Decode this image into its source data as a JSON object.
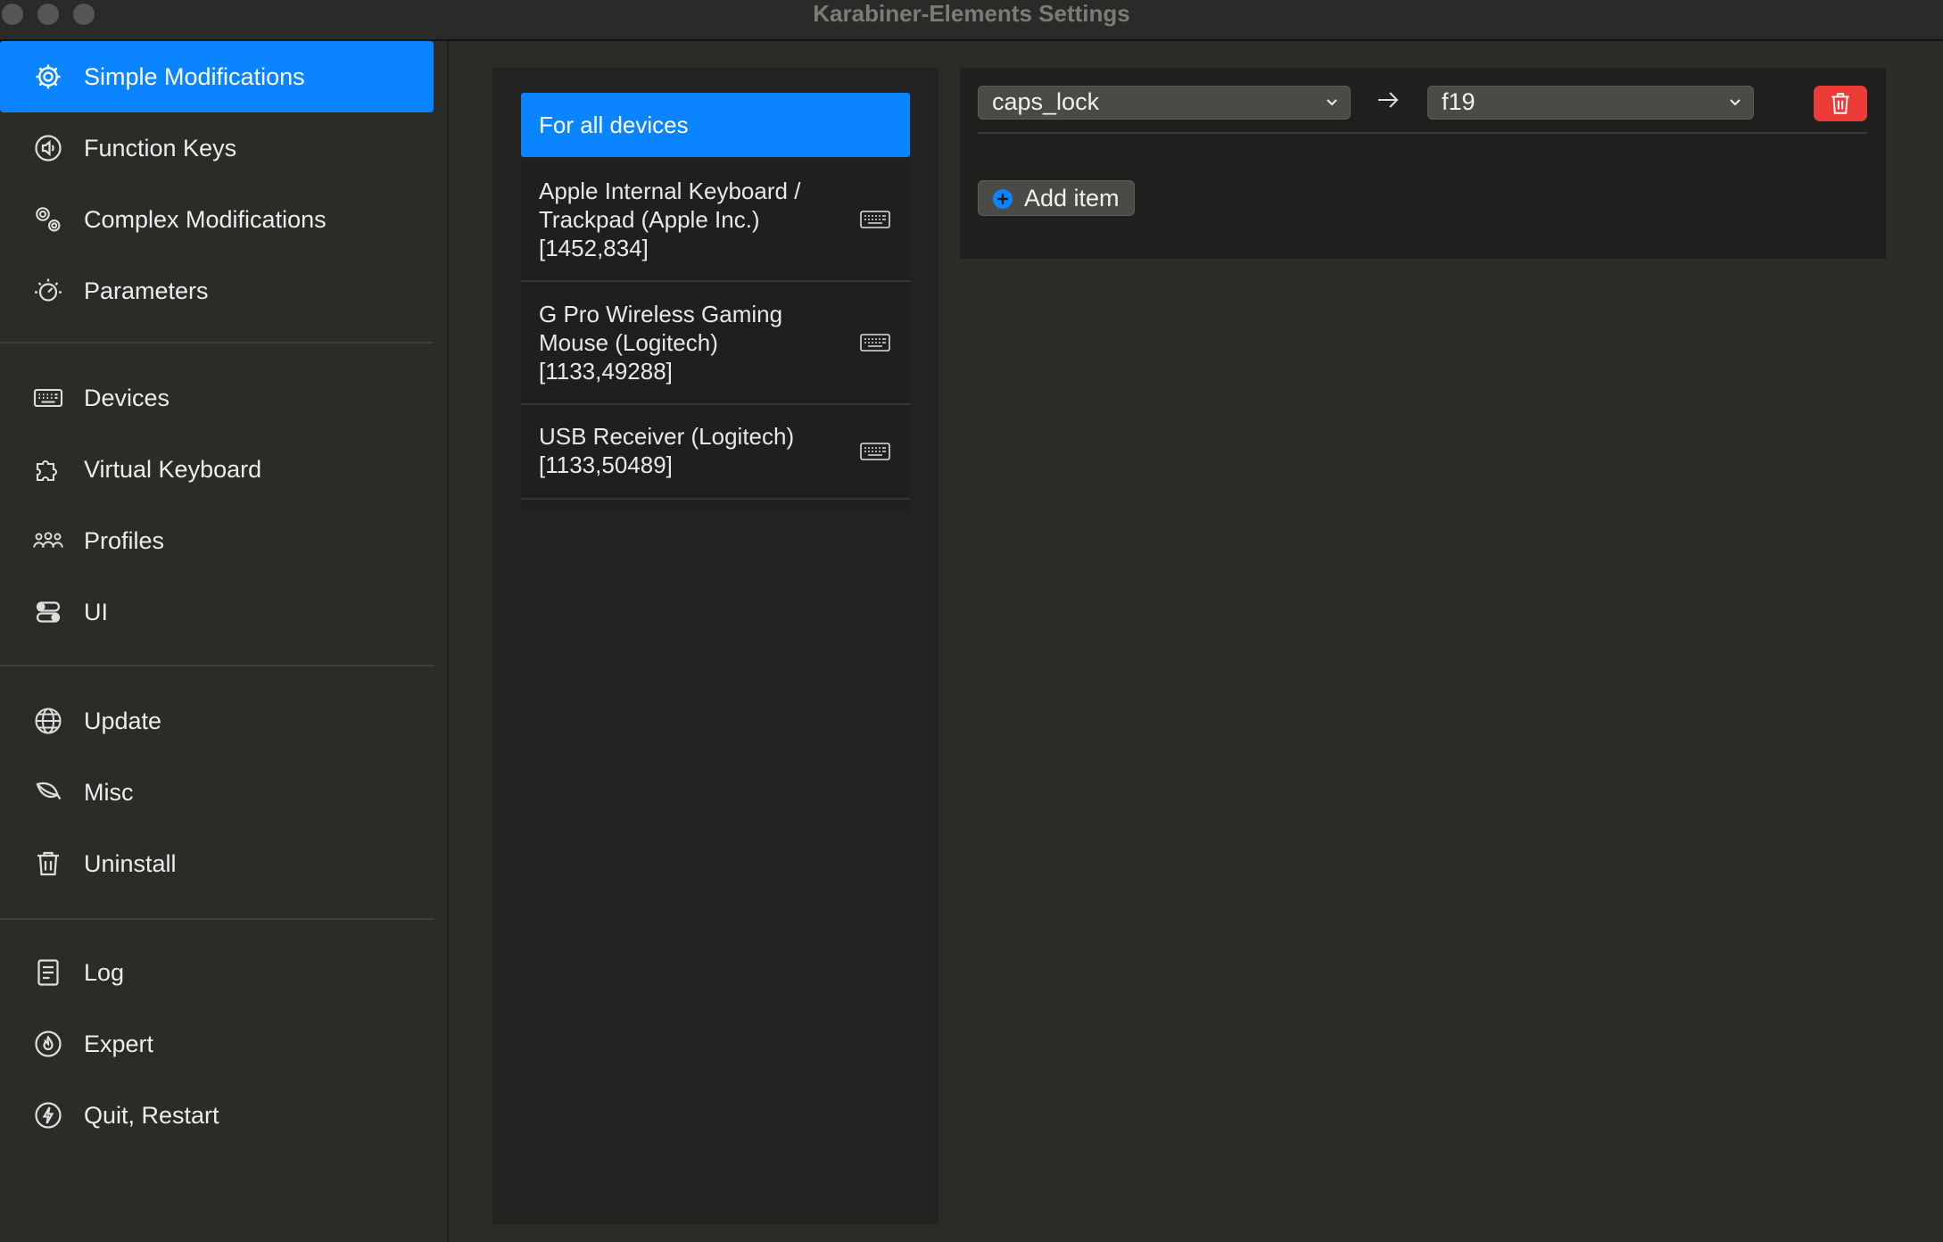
{
  "window": {
    "title": "Karabiner-Elements Settings"
  },
  "sidebar": {
    "items": [
      {
        "label": "Simple Modifications",
        "icon": "gear-icon",
        "active": true
      },
      {
        "label": "Function Keys",
        "icon": "speaker-icon"
      },
      {
        "label": "Complex Modifications",
        "icon": "gears-icon"
      },
      {
        "label": "Parameters",
        "icon": "dial-icon"
      },
      {
        "label": "Devices",
        "icon": "keyboard-icon"
      },
      {
        "label": "Virtual Keyboard",
        "icon": "puzzle-icon"
      },
      {
        "label": "Profiles",
        "icon": "people-icon"
      },
      {
        "label": "UI",
        "icon": "toggles-icon"
      },
      {
        "label": "Update",
        "icon": "globe-icon"
      },
      {
        "label": "Misc",
        "icon": "leaf-icon"
      },
      {
        "label": "Uninstall",
        "icon": "trash-icon"
      },
      {
        "label": "Log",
        "icon": "document-icon"
      },
      {
        "label": "Expert",
        "icon": "flame-icon"
      },
      {
        "label": "Quit, Restart",
        "icon": "bolt-icon"
      }
    ]
  },
  "devices": {
    "items": [
      {
        "name": "For all devices",
        "selected": true
      },
      {
        "name": "Apple Internal Keyboard /\nTrackpad (Apple Inc.)\n[1452,834]",
        "icon": "keyboard-icon"
      },
      {
        "name": "G Pro Wireless Gaming\nMouse (Logitech)\n[1133,49288]",
        "icon": "keyboard-icon"
      },
      {
        "name": "USB Receiver (Logitech)\n[1133,50489]",
        "icon": "keyboard-icon"
      }
    ]
  },
  "modifications": {
    "rows": [
      {
        "from": "caps_lock",
        "to": "f19"
      }
    ],
    "add_item_label": "Add item"
  },
  "colors": {
    "accent": "#0a84ff",
    "delete": "#ec3b36",
    "background": "#2b2c28"
  }
}
